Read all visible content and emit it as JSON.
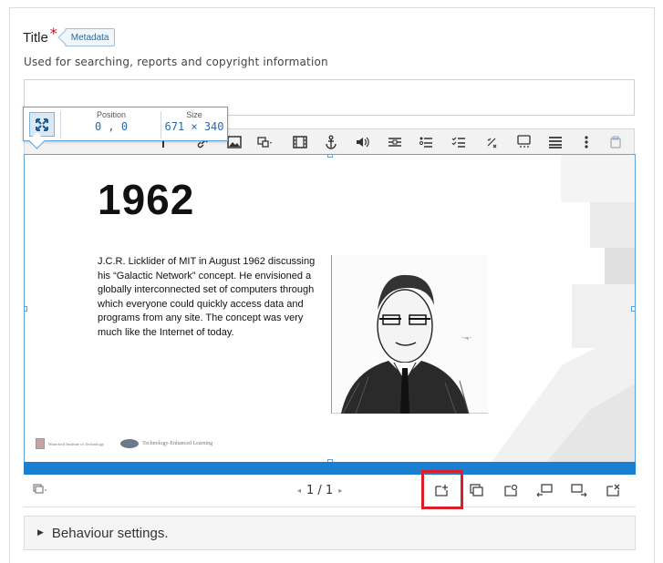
{
  "title_field": {
    "label": "Title",
    "required_mark": "*",
    "metadata_button": "Metadata",
    "description": "Used for searching, reports and copyright information",
    "value": ""
  },
  "position_size": {
    "position_label": "Position",
    "position_value": "0 , 0",
    "size_label": "Size",
    "size_value": "671 × 340"
  },
  "toolbar": {
    "tools": [
      "text-icon",
      "link-icon",
      "image-icon",
      "shapes-icon",
      "video-icon",
      "anchor-icon",
      "audio-icon",
      "fill-in-blanks-icon",
      "single-choice-icon",
      "multi-choice-icon",
      "true-false-icon",
      "drag-text-icon",
      "summary-icon",
      "more-icon",
      "paste-icon"
    ]
  },
  "slide": {
    "year": "1962",
    "paragraph": "J.C.R. Licklider of MIT in August 1962 discussing his “Galactic Network” concept. He envisioned a globally interconnected set of computers through which everyone could quickly access data and programs from any site. The concept was very much like the Internet of today.",
    "logo1_text": "Waterford Institute of Technology",
    "logo2_text": "Technology-Enhanced Learning"
  },
  "slide_nav": {
    "prev": "◂",
    "counter": "1 / 1",
    "next": "▸",
    "buttons": [
      "new-slide-icon",
      "clone-slide-icon",
      "slide-background-icon",
      "move-slide-left-icon",
      "move-slide-right-icon",
      "delete-slide-icon"
    ]
  },
  "behaviour": {
    "label": "Behaviour settings."
  },
  "colors": {
    "accent": "#1a7fd1",
    "highlight": "#d9202a",
    "required": "#d0021b"
  }
}
